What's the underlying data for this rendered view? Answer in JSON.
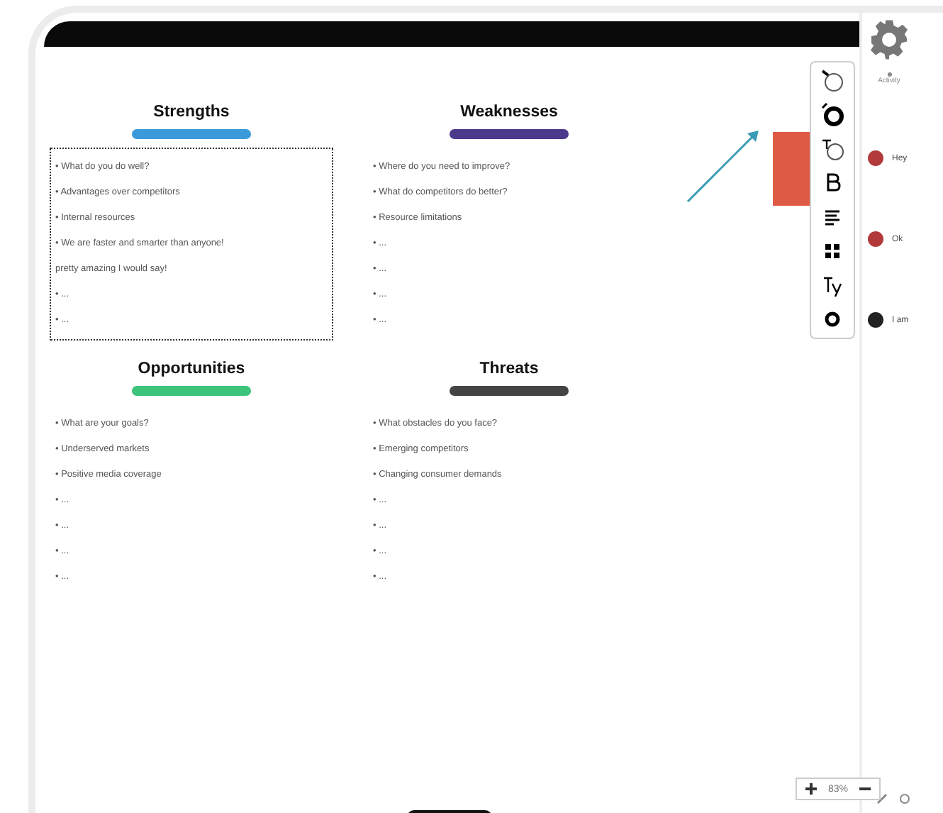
{
  "quadrants": [
    {
      "title": "Strengths",
      "color": "#3b9ad9",
      "selected": true,
      "items": [
        "• What do you do well?",
        "• Advantages over competitors",
        "• Internal resources",
        "• We are faster and smarter than anyone!",
        "pretty amazing I would say!",
        "• ...",
        "• ..."
      ]
    },
    {
      "title": "Weaknesses",
      "color": "#4b3a8c",
      "selected": false,
      "items": [
        "• Where do you need to improve?",
        "• What do competitors do better?",
        "• Resource limitations",
        "• ...",
        "• ...",
        "• ...",
        "• ..."
      ]
    },
    {
      "title": "Opportunities",
      "color": "#3cc47c",
      "selected": false,
      "items": [
        "• What are your goals?",
        "• Underserved markets",
        "• Positive media coverage",
        "• ...",
        "• ...",
        "• ...",
        "• ..."
      ]
    },
    {
      "title": "Threats",
      "color": "#444444",
      "selected": false,
      "items": [
        "• What obstacles do you face?",
        "• Emerging competitors",
        "• Changing consumer demands",
        "• ...",
        "• ...",
        "• ...",
        "• ..."
      ]
    }
  ],
  "zoom": {
    "value": "83%"
  },
  "sidebar": {
    "tab": "Activity",
    "messages": [
      {
        "text": "Hey",
        "color": "#b23a3a"
      },
      {
        "text": "Ok",
        "color": "#b23a3a"
      },
      {
        "text": "I am",
        "color": "#222222"
      }
    ]
  }
}
